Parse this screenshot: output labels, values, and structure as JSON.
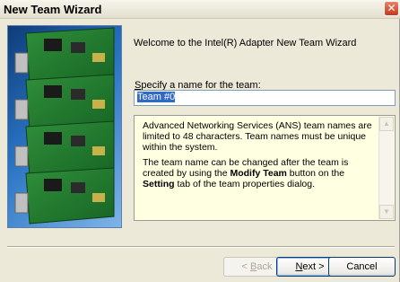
{
  "window": {
    "title": "New Team Wizard"
  },
  "welcome": "Welcome to the Intel(R) Adapter New Team Wizard",
  "name_field": {
    "label_underlined": "S",
    "label_rest": "pecify a name for the team:",
    "value": "Team #0"
  },
  "info": {
    "paragraph1": "Advanced Networking Services (ANS) team names are limited to 48 characters. Team names must be unique within the system.",
    "paragraph2_a": "The team name can be changed after the team is created by using the ",
    "paragraph2_b1": "Modify Team",
    "paragraph2_c": " button on the ",
    "paragraph2_b2": "Setting",
    "paragraph2_d": " tab of the team properties dialog."
  },
  "buttons": {
    "back_prefix": "< ",
    "back_u": "B",
    "back_rest": "ack",
    "next_u": "N",
    "next_rest": "ext >",
    "cancel": "Cancel"
  },
  "icons": {
    "close": "close-icon",
    "scroll_up": "scroll-up-icon",
    "scroll_down": "scroll-down-icon"
  }
}
